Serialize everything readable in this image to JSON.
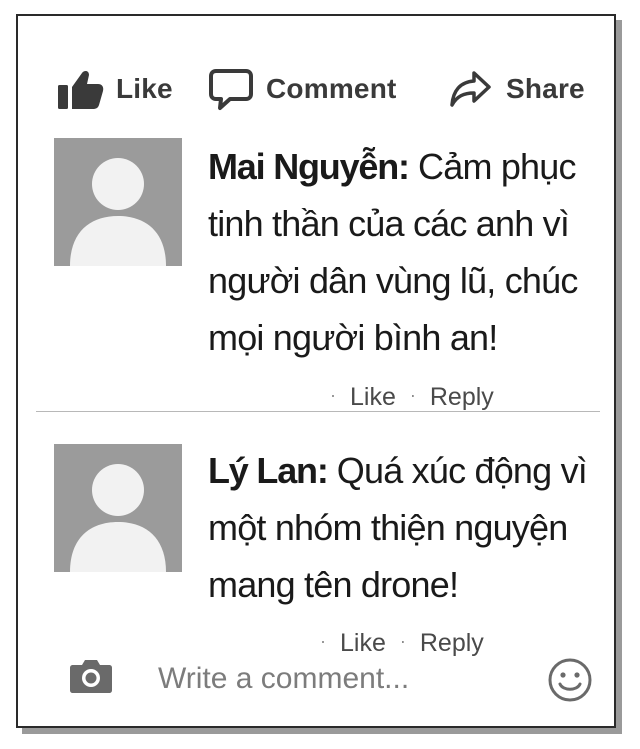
{
  "actions": {
    "like_label": "Like",
    "comment_label": "Comment",
    "share_label": "Share"
  },
  "comments": [
    {
      "author": "Mai Nguyễn:",
      "text": " Cảm phục tinh thần của các anh vì người dân vùng lũ, chúc mọi người bình an!",
      "like_label": "Like",
      "reply_label": "Reply"
    },
    {
      "author": "Lý Lan:",
      "text": " Quá xúc động vì một nhóm thiện nguyện mang tên drone!",
      "like_label": "Like",
      "reply_label": "Reply"
    }
  ],
  "composer": {
    "placeholder": "Write a comment..."
  },
  "icons": {
    "like": "thumbs-up-icon",
    "comment": "speech-bubble-icon",
    "share": "share-arrow-icon",
    "avatar": "default-profile-silhouette",
    "camera": "camera-icon",
    "emoji": "smiley-face-icon"
  },
  "colors": {
    "icon": "#3a3a3a",
    "avatar_bg": "#9b9b9b",
    "avatar_figure": "#f2f2f2",
    "muted_text": "#7c7c7c"
  }
}
